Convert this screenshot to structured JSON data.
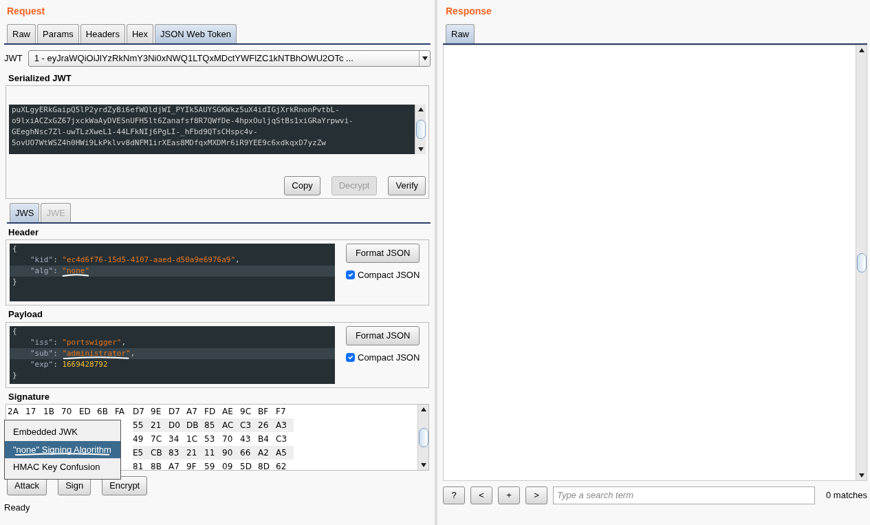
{
  "request": {
    "title": "Request",
    "tabs": [
      {
        "label": "Raw",
        "selected": false
      },
      {
        "label": "Params",
        "selected": false
      },
      {
        "label": "Headers",
        "selected": false
      },
      {
        "label": "Hex",
        "selected": false
      },
      {
        "label": "JSON Web Token",
        "selected": true
      }
    ],
    "jwt_label": "JWT",
    "jwt_select": "1 - eyJraWQiOiJlYzRkNmY3Ni0xNWQ1LTQxMDctYWFlZC1kNTBhOWU2OTc ...",
    "serialized": {
      "title": "Serialized JWT",
      "lines": [
        "puXLgyERkGaipQ5lP2yrdZyBi6efWQldjWI_PYIk5AUYSGKWkz5uX4idIGjXrkRnonPvtbL-",
        "o9lxiACZxGZ67jxckWaAyDVESnUFH5lt6Zanafsf8R7QWfDe-4hpxOuljqStBs1xiGRaYrpwvi-",
        "GEeghNsc7Zl-uwTLzXweL1-44LFkNIj6PgLI-_hFbd9QTsCHspc4v-",
        "5ovUO7WtWSZ4h0HWi9LkPklvv8dNFM1irXEas8MDfqxMXDMr6iR9YEE9c6xdkqxD7yzZw"
      ],
      "buttons": [
        {
          "label": "Copy",
          "disabled": false
        },
        {
          "label": "Decrypt",
          "disabled": true
        },
        {
          "label": "Verify",
          "disabled": false
        }
      ]
    },
    "sub_tabs": [
      {
        "label": "JWS",
        "selected": true,
        "disabled": false
      },
      {
        "label": "JWE",
        "selected": false,
        "disabled": true
      }
    ],
    "sections": [
      {
        "title": "Header",
        "format_button": "Format JSON",
        "compact": {
          "label": "Compact JSON",
          "checked": true
        },
        "lines": [
          {
            "kind": "brace",
            "highlighted": false,
            "tokens": [
              {
                "kind": "punct",
                "text": "{"
              }
            ]
          },
          {
            "kind": "pair",
            "highlighted": false,
            "tokens": [
              {
                "kind": "key",
                "text": "\"kid\""
              },
              {
                "kind": "punct",
                "text": ": "
              },
              {
                "kind": "string",
                "text": "\"ec4d6f76-15d5-4107-aaed-d50a9e6976a9\""
              },
              {
                "kind": "punct",
                "text": ","
              }
            ]
          },
          {
            "kind": "pair",
            "highlighted": true,
            "tokens": [
              {
                "kind": "key",
                "text": "\"alg\""
              },
              {
                "kind": "punct",
                "text": ": "
              },
              {
                "kind": "string",
                "text": "\"none\"",
                "underlined": true
              }
            ]
          },
          {
            "kind": "brace",
            "highlighted": false,
            "tokens": [
              {
                "kind": "punct",
                "text": "}"
              }
            ]
          }
        ]
      },
      {
        "title": "Payload",
        "format_button": "Format JSON",
        "compact": {
          "label": "Compact JSON",
          "checked": true
        },
        "lines": [
          {
            "kind": "brace",
            "highlighted": false,
            "tokens": [
              {
                "kind": "punct",
                "text": "{"
              }
            ]
          },
          {
            "kind": "pair",
            "highlighted": false,
            "tokens": [
              {
                "kind": "key",
                "text": "\"iss\""
              },
              {
                "kind": "punct",
                "text": ": "
              },
              {
                "kind": "string",
                "text": "\"portswigger\""
              },
              {
                "kind": "punct",
                "text": ","
              }
            ]
          },
          {
            "kind": "pair",
            "highlighted": true,
            "tokens": [
              {
                "kind": "key",
                "text": "\"sub\""
              },
              {
                "kind": "punct",
                "text": ": "
              },
              {
                "kind": "string",
                "text": "\"administrator\"",
                "underlined": true
              },
              {
                "kind": "punct",
                "text": ","
              }
            ]
          },
          {
            "kind": "pair",
            "highlighted": false,
            "tokens": [
              {
                "kind": "key",
                "text": "\"exp\""
              },
              {
                "kind": "punct",
                "text": ": "
              },
              {
                "kind": "number",
                "text": "1669428792"
              }
            ]
          },
          {
            "kind": "brace",
            "highlighted": false,
            "tokens": [
              {
                "kind": "punct",
                "text": "}"
              }
            ]
          }
        ]
      }
    ],
    "signature": {
      "title": "Signature",
      "rows": [
        [
          "2A",
          "17",
          "1B",
          "70",
          "ED",
          "6B",
          "FA",
          "D7",
          "9E",
          "D7",
          "A7",
          "FD",
          "AE",
          "9C",
          "BF",
          "F7"
        ],
        [
          "",
          "",
          "",
          "",
          "",
          "",
          "",
          "55",
          "21",
          "D0",
          "DB",
          "85",
          "AC",
          "C3",
          "26",
          "A3"
        ],
        [
          "",
          "",
          "",
          "",
          "",
          "",
          "",
          "49",
          "7C",
          "34",
          "1C",
          "53",
          "70",
          "43",
          "B4",
          "C3"
        ],
        [
          "",
          "",
          "",
          "",
          "",
          "",
          "",
          "E5",
          "CB",
          "83",
          "21",
          "11",
          "90",
          "66",
          "A2",
          "A5"
        ],
        [
          "",
          "",
          "",
          "",
          "",
          "",
          "",
          "81",
          "8B",
          "A7",
          "9F",
          "59",
          "09",
          "5D",
          "8D",
          "62"
        ]
      ]
    },
    "attack_menu": [
      {
        "label": "Embedded JWK",
        "selected": false,
        "underlined": false
      },
      {
        "label": "\"none\" Signing Algorithm",
        "selected": true,
        "underlined": true
      },
      {
        "label": "HMAC Key Confusion",
        "selected": false,
        "underlined": false
      }
    ],
    "actions": [
      "Attack",
      "Sign",
      "Encrypt"
    ],
    "status": "Ready"
  },
  "response": {
    "title": "Response",
    "tabs": [
      {
        "label": "Raw",
        "selected": true
      }
    ],
    "search": {
      "buttons": [
        "?",
        "<",
        "+",
        ">"
      ],
      "placeholder": "Type a search term",
      "matches": "0 matches"
    }
  }
}
